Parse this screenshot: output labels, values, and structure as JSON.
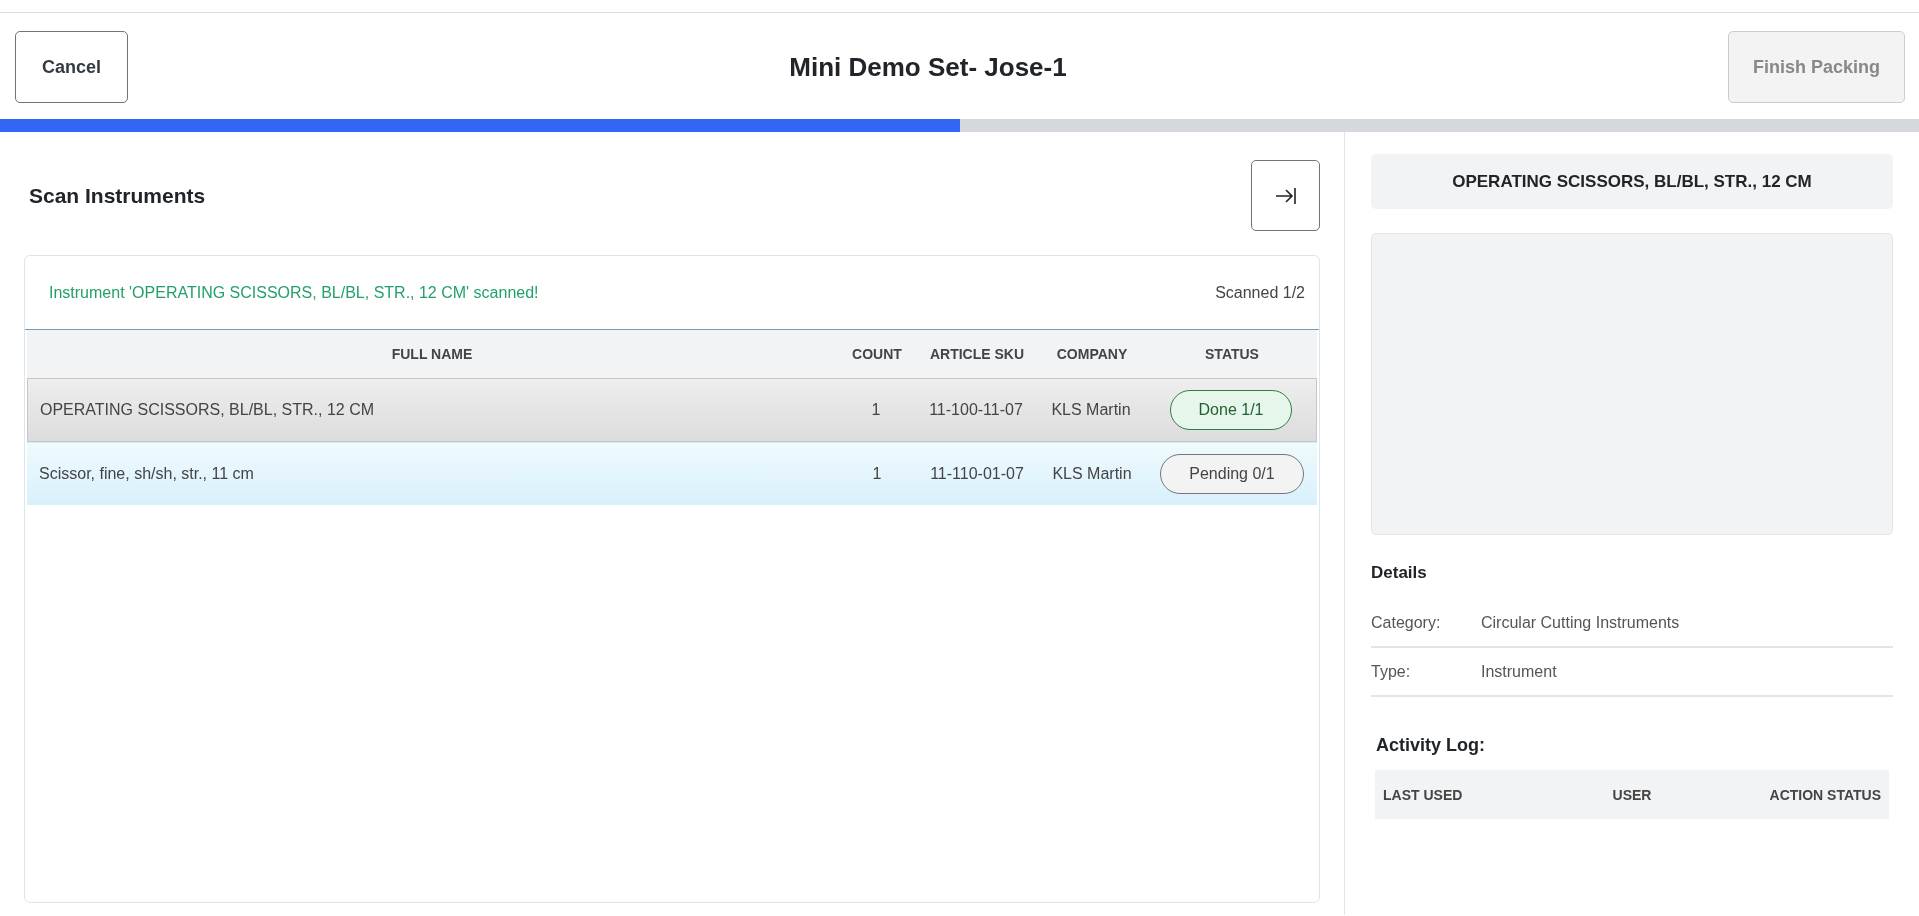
{
  "header": {
    "cancel_button": "Cancel",
    "title": "Mini Demo Set- Jose-1",
    "finish_button": {
      "label": "Finish Packing",
      "disabled": true
    }
  },
  "progress": {
    "level": 0.5
  },
  "scan_panel": {
    "title": "Scan Instruments",
    "message": "Instrument 'OPERATING SCISSORS, BL/BL, STR., 12 CM' scanned!",
    "scanned": "Scanned 1/2",
    "table": {
      "columns": [
        "FULL NAME",
        "COUNT",
        "ARTICLE SKU",
        "COMPANY",
        "STATUS"
      ],
      "rows": [
        {
          "full_name": "OPERATING SCISSORS, BL/BL, STR., 12 CM",
          "count": "1",
          "sku": "11-100-11-07",
          "company": "KLS Martin",
          "status": {
            "label": "Done 1/1",
            "kind": "done"
          },
          "selected": true
        },
        {
          "full_name": "Scissor, fine, sh/sh, str., 11 cm",
          "count": "1",
          "sku": "11-110-01-07",
          "company": "KLS Martin",
          "status": {
            "label": "Pending 0/1",
            "kind": "pending"
          },
          "selected": false
        }
      ]
    }
  },
  "detail_panel": {
    "title": "OPERATING SCISSORS, BL/BL, STR., 12 CM",
    "details_heading": "Details",
    "details": [
      {
        "label": "Category:",
        "value": "Circular Cutting Instruments"
      },
      {
        "label": "Type:",
        "value": "Instrument"
      }
    ],
    "activity_log": {
      "title": "Activity Log:",
      "columns": [
        "LAST USED",
        "USER",
        "ACTION STATUS"
      ]
    }
  }
}
